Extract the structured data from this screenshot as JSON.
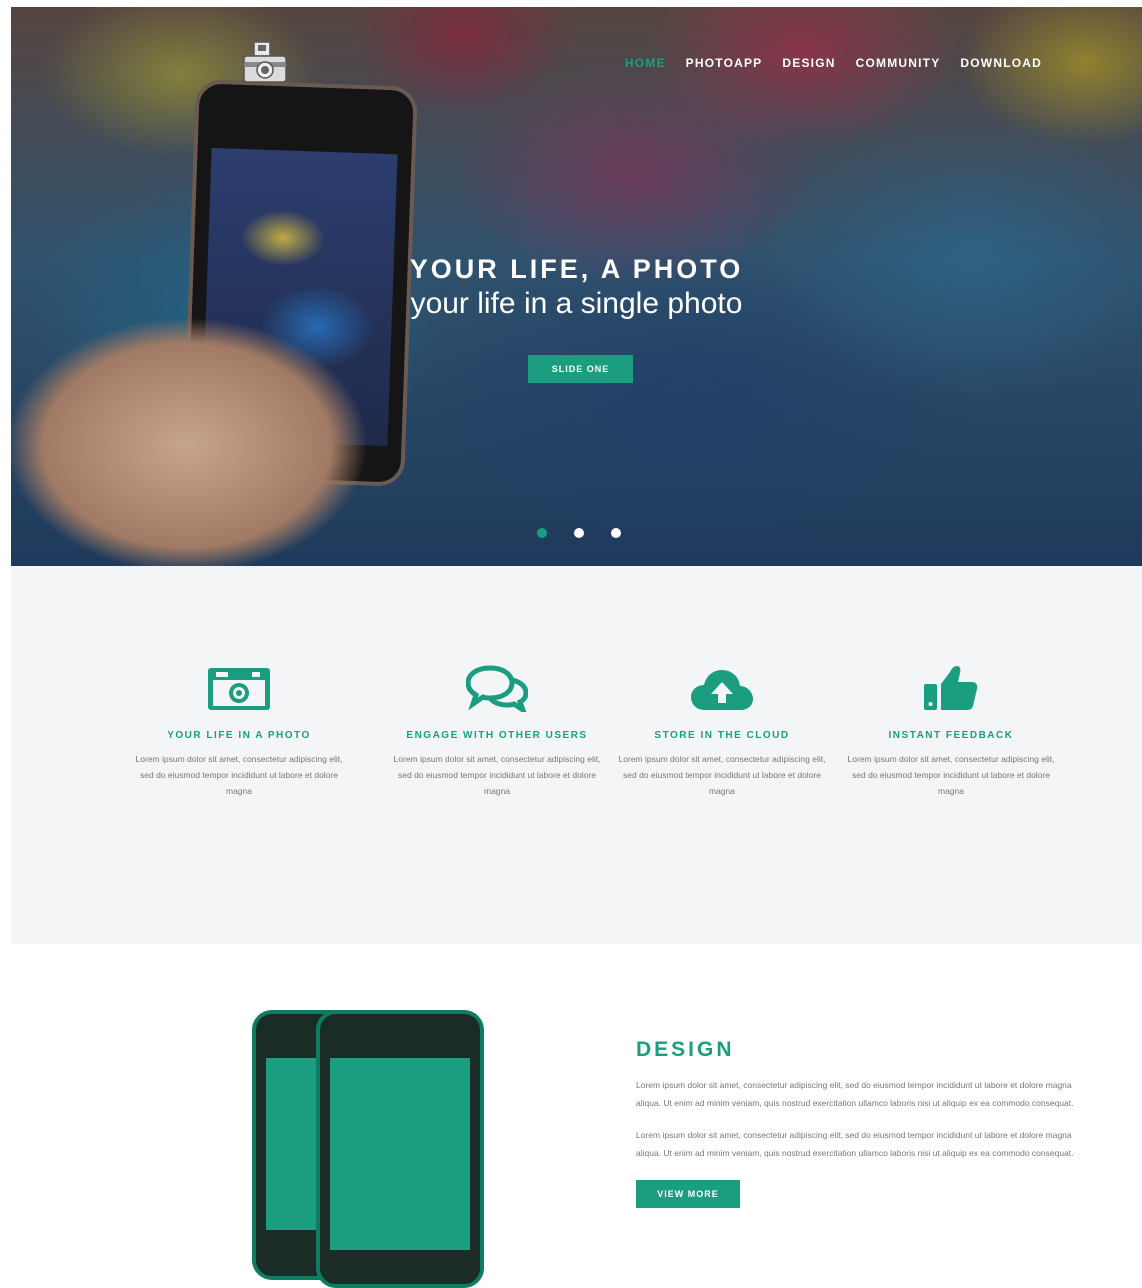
{
  "nav": {
    "items": [
      {
        "label": "HOME",
        "active": true
      },
      {
        "label": "PHOTOAPP",
        "active": false
      },
      {
        "label": "DESIGN",
        "active": false
      },
      {
        "label": "COMMUNITY",
        "active": false
      },
      {
        "label": "DOWNLOAD",
        "active": false
      }
    ]
  },
  "hero": {
    "title": "YOUR LIFE, A PHOTO",
    "subtitle": "your life in a single photo",
    "button_label": "SLIDE ONE",
    "slides": [
      {
        "active": true
      },
      {
        "active": false
      },
      {
        "active": false
      }
    ]
  },
  "features": [
    {
      "icon": "camera-icon",
      "title": "YOUR LIFE IN A PHOTO",
      "text": "Lorem ipsum dolor sit amet, consectetur adipiscing elit, sed do eiusmod tempor incididunt ut labore et dolore magna"
    },
    {
      "icon": "chat-icon",
      "title": "ENGAGE WITH OTHER USERS",
      "text": "Lorem ipsum dolor sit amet, consectetur adipiscing elit, sed do eiusmod tempor incididunt ut labore et dolore magna"
    },
    {
      "icon": "cloud-upload-icon",
      "title": "STORE IN THE CLOUD",
      "text": "Lorem ipsum dolor sit amet, consectetur adipiscing elit, sed do eiusmod tempor incididunt ut labore et dolore magna"
    },
    {
      "icon": "thumbs-up-icon",
      "title": "INSTANT FEEDBACK",
      "text": "Lorem ipsum dolor sit amet, consectetur adipiscing elit, sed do eiusmod tempor incididunt ut labore et dolore magna"
    }
  ],
  "design": {
    "title": "DESIGN",
    "paragraphs": [
      "Lorem ipsum dolor sit amet, consectetur adipiscing elit, sed do eiusmod tempor incididunt ut labore et dolore magna aliqua. Ut enim ad minim veniam, quis nostrud exercitation ullamco laboris nisi ut aliquip ex ea commodo consequat.",
      "Lorem ipsum dolor sit amet, consectetur adipiscing elit, sed do eiusmod tempor incididunt ut labore et dolore magna aliqua. Ut enim ad minim veniam, quis nostrud exercitation ullamco laboris nisi ut aliquip ex ea commodo consequat."
    ],
    "button_label": "VIEW MORE"
  },
  "colors": {
    "accent": "#1a9e7f",
    "section_bg": "#f4f5f7"
  }
}
